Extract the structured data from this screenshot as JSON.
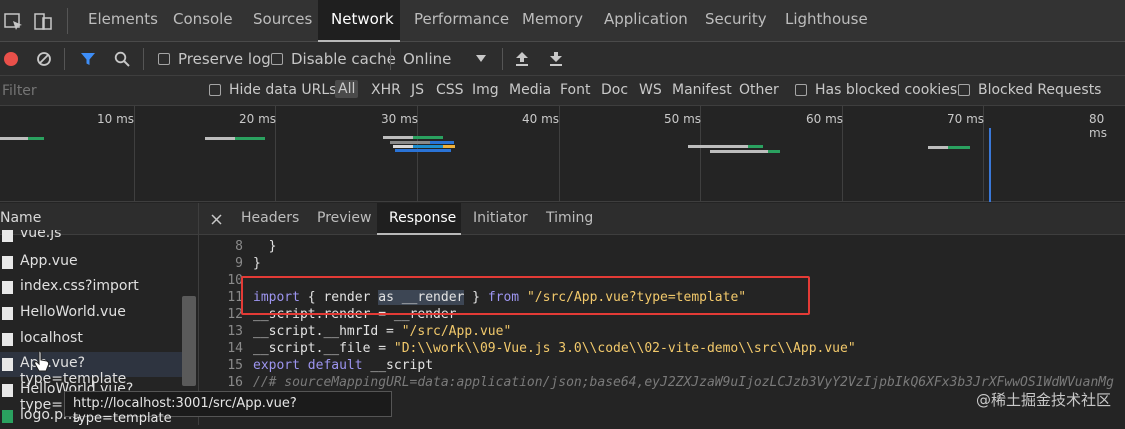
{
  "devtools": {
    "tabs": [
      "Elements",
      "Console",
      "Sources",
      "Network",
      "Performance",
      "Memory",
      "Application",
      "Security",
      "Lighthouse"
    ],
    "active_tab": "Network"
  },
  "toolbar": {
    "preserve_log": "Preserve log",
    "disable_cache": "Disable cache",
    "throttling": "Online"
  },
  "filter": {
    "placeholder": "Filter",
    "hide_data_urls": "Hide data URLs",
    "types": [
      "All",
      "XHR",
      "JS",
      "CSS",
      "Img",
      "Media",
      "Font",
      "Doc",
      "WS",
      "Manifest",
      "Other"
    ],
    "has_blocked_cookies": "Has blocked cookies",
    "blocked_requests": "Blocked Requests"
  },
  "overview": {
    "ticks": [
      "10 ms",
      "20 ms",
      "30 ms",
      "40 ms",
      "50 ms",
      "60 ms",
      "70 ms",
      "80 ms"
    ]
  },
  "requests": {
    "header": "Name",
    "rows": [
      "vue.js",
      "App.vue",
      "index.css?import",
      "HelloWorld.vue",
      "localhost",
      "App.vue?type=template",
      "HelloWorld.vue?type=...",
      "logo.png"
    ],
    "tooltip": "http://localhost:3001/src/App.vue?type=template"
  },
  "detail": {
    "tabs": [
      "Headers",
      "Preview",
      "Response",
      "Initiator",
      "Timing"
    ],
    "active_tab": "Response"
  },
  "code": {
    "line_numbers": [
      "8",
      "9",
      "10",
      "11",
      "12",
      "13",
      "14",
      "15",
      "16"
    ],
    "l8": "  }",
    "l9": "}",
    "l11_kw1": "import",
    "l11_a": " { render ",
    "l11_hl": "as __render",
    "l11_b": " } ",
    "l11_kw2": "from",
    "l11_c": " ",
    "l11_str": "\"/src/App.vue?type=template\"",
    "l12": "__script.render = __render",
    "l13_a": "__script.__hmrId = ",
    "l13_str": "\"/src/App.vue\"",
    "l14_a": "__script.__file = ",
    "l14_str": "\"D:\\\\work\\\\09-Vue.js 3.0\\\\code\\\\02-vite-demo\\\\src\\\\App.vue\"",
    "l15_kw": "export default",
    "l15_a": " __script",
    "l16": "//# sourceMappingURL=data:application/json;base64,eyJ2ZXJzaW9uIjozLCJzb3VyY2VzIjpbIkQ6XFx3b3JrXFwwOS1WdWVuanMg"
  },
  "watermark": "@稀土掘金技术社区",
  "colors": {
    "highlight_box": "#e43b36",
    "active_tab_bg": "#1f1f1f",
    "keyword": "#9d95f0",
    "string": "#f2c96b",
    "filter_blue": "#3e8ef7",
    "record_red": "#e9504a"
  },
  "icons": [
    "inspect-icon",
    "device-toggle-icon",
    "record-icon",
    "clear-icon",
    "filter-icon",
    "search-icon",
    "dropdown-icon",
    "upload-icon",
    "download-icon",
    "close-icon",
    "file-icon",
    "cursor-icon"
  ]
}
